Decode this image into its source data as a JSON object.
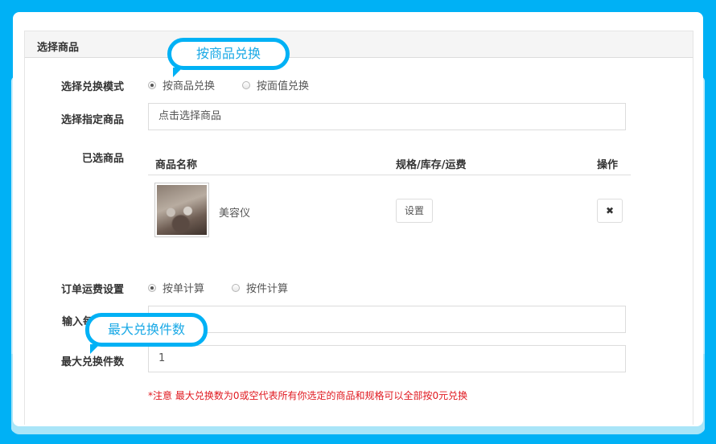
{
  "panel": {
    "title": "选择商品"
  },
  "callouts": {
    "top": "按商品兑换",
    "bottom": "最大兑换件数"
  },
  "exchange_mode": {
    "label": "选择兑换模式",
    "options": [
      {
        "label": "按商品兑换",
        "checked": true
      },
      {
        "label": "按面值兑换",
        "checked": false
      }
    ]
  },
  "product_select": {
    "label": "选择指定商品",
    "value": "点击选择商品"
  },
  "selected": {
    "label": "已选商品",
    "headers": {
      "name": "商品名称",
      "spec": "规格/库存/运费",
      "action": "操作"
    },
    "rows": [
      {
        "name": "美容仪",
        "spec_button": "设置",
        "delete_icon": "✖"
      }
    ]
  },
  "shipping": {
    "label": "订单运费设置",
    "options": [
      {
        "label": "按单计算",
        "checked": true
      },
      {
        "label": "按件计算",
        "checked": false
      }
    ]
  },
  "per_input": {
    "label": "输入每",
    "value": ""
  },
  "max_qty": {
    "label": "最大兑换件数",
    "value": "1"
  },
  "notice": "*注意 最大兑换数为0或空代表所有你选定的商品和规格可以全部按0元兑换",
  "colors": {
    "accent": "#00b1f5",
    "notice": "#e0181f"
  }
}
